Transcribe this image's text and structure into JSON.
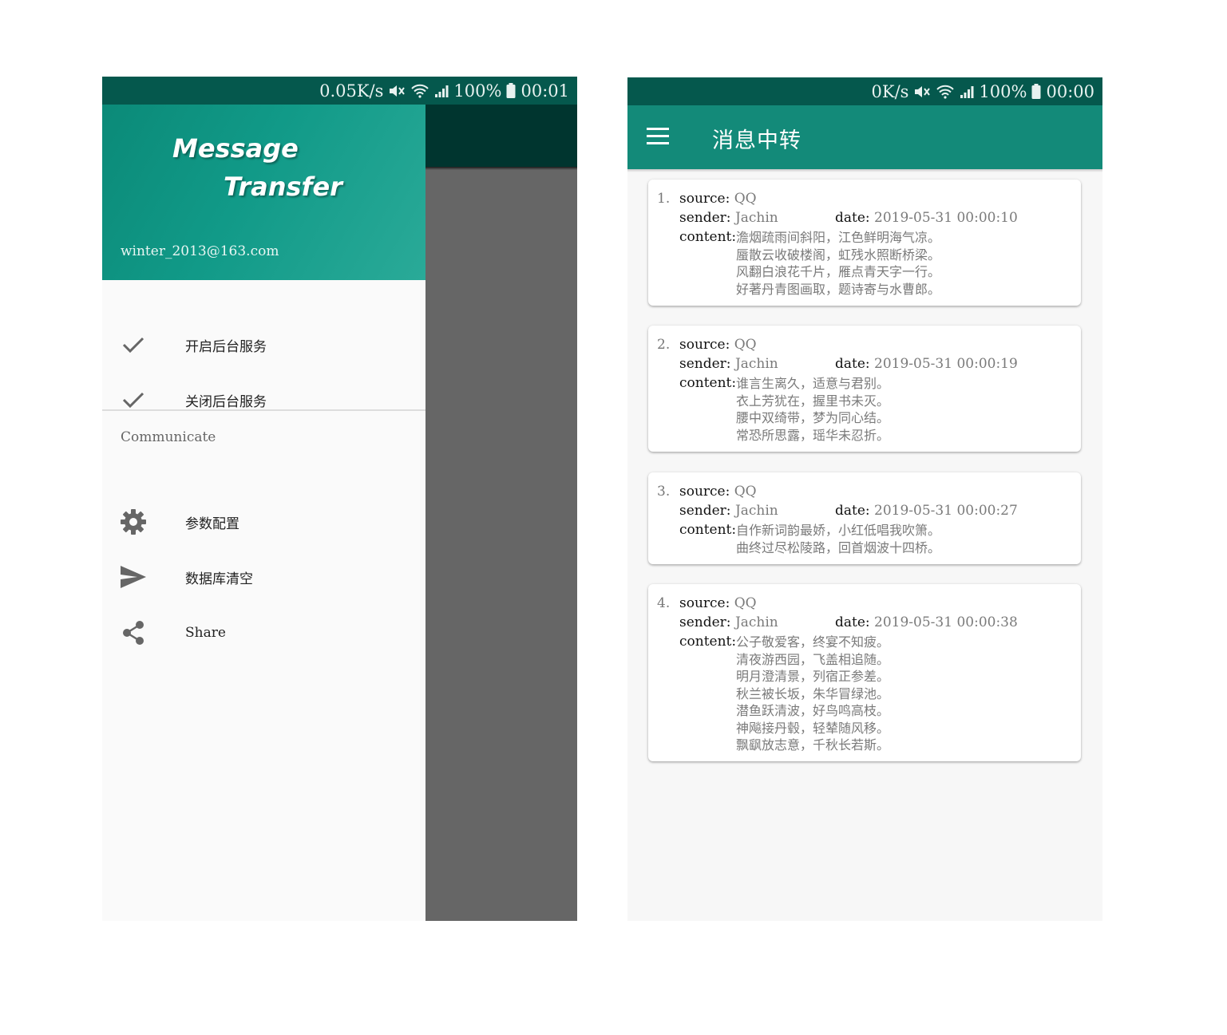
{
  "left_screen": {
    "status_bar": {
      "speed": "0.05K/s",
      "battery": "100%",
      "time": "00:01"
    },
    "drawer": {
      "logo_line1": "Message",
      "logo_line2": "Transfer",
      "email": "winter_2013@163.com",
      "items": [
        {
          "label": "开启后台服务",
          "icon": "check-icon"
        },
        {
          "label": "关闭后台服务",
          "icon": "check-icon"
        }
      ],
      "section_title": "Communicate",
      "section_items": [
        {
          "label": "参数配置",
          "icon": "gear-icon"
        },
        {
          "label": "数据库清空",
          "icon": "send-icon"
        },
        {
          "label": "Share",
          "icon": "share-icon"
        }
      ]
    }
  },
  "right_screen": {
    "status_bar": {
      "speed": "0K/s",
      "battery": "100%",
      "time": "00:00"
    },
    "toolbar": {
      "title": "消息中转",
      "menu_icon": "hamburger-menu-icon"
    },
    "labels": {
      "source": "source:",
      "sender": "sender:",
      "date": "date:",
      "content": "content:"
    },
    "messages": [
      {
        "index": "1.",
        "source": "QQ",
        "sender": "Jachin",
        "date": "2019-05-31 00:00:10",
        "content": [
          "澹烟疏雨间斜阳，江色鲜明海气凉。",
          "蜃散云收破楼阁，虹残水照断桥梁。",
          "风翻白浪花千片，雁点青天字一行。",
          "好著丹青图画取，题诗寄与水曹郎。"
        ]
      },
      {
        "index": "2.",
        "source": "QQ",
        "sender": "Jachin",
        "date": "2019-05-31 00:00:19",
        "content": [
          "谁言生离久，适意与君别。",
          "衣上芳犹在，握里书未灭。",
          "腰中双绮带，梦为同心结。",
          "常恐所思露，瑶华未忍折。"
        ]
      },
      {
        "index": "3.",
        "source": "QQ",
        "sender": "Jachin",
        "date": "2019-05-31 00:00:27",
        "content": [
          "自作新词韵最娇，小红低唱我吹箫。",
          "曲终过尽松陵路，回首烟波十四桥。"
        ]
      },
      {
        "index": "4.",
        "source": "QQ",
        "sender": "Jachin",
        "date": "2019-05-31 00:00:38",
        "content": [
          "公子敬爱客，终宴不知疲。",
          "清夜游西园，飞盖相追随。",
          "明月澄清景，列宿正参差。",
          "秋兰被长坂，朱华冒绿池。",
          "潜鱼跃清波，好鸟鸣高枝。",
          "神飚接丹毂，轻辇随风移。",
          "飘飖放志意，千秋长若斯。"
        ]
      }
    ]
  }
}
